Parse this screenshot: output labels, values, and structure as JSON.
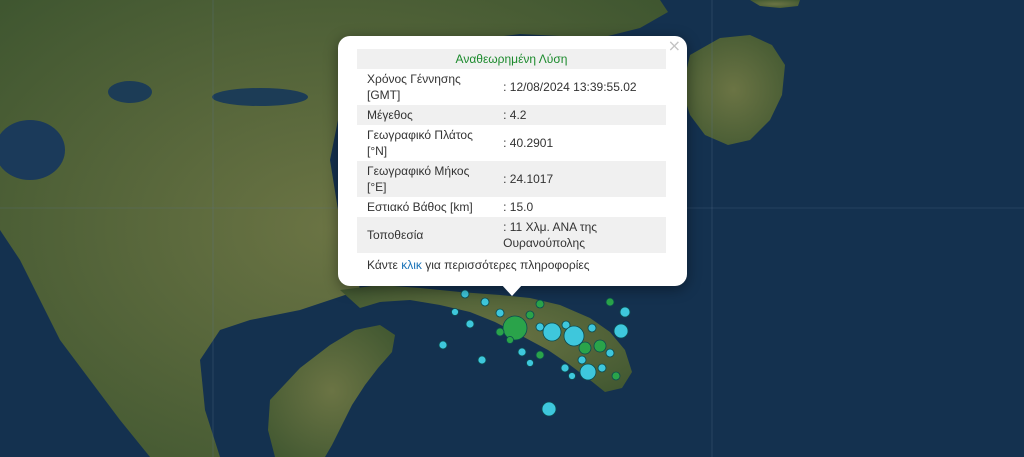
{
  "popup": {
    "header": "Αναθεωρημένη Λύση",
    "rows": [
      {
        "label_line1": "Χρόνος Γέννησης",
        "label_line2": "[GMT]",
        "value": ": 12/08/2024 13:39:55.02"
      },
      {
        "label_line1": "Μέγεθος",
        "label_line2": "",
        "value": ": 4.2"
      },
      {
        "label_line1": "Γεωγραφικό Πλάτος",
        "label_line2": "[°N]",
        "value": ": 40.2901"
      },
      {
        "label_line1": "Γεωγραφικό Μήκος",
        "label_line2": "[°E]",
        "value": ": 24.1017"
      },
      {
        "label_line1": "Εστιακό Βάθος [km]",
        "label_line2": "",
        "value": ": 15.0"
      },
      {
        "label_line1": "Τοποθεσία",
        "label_line2": "",
        "value_line1": ": 11 Χλμ. ΑΝΑ της",
        "value_line2": "Ουρανούπολης"
      }
    ],
    "more_prefix": "Κάντε ",
    "more_link": "κλικ",
    "more_suffix": " για περισσότερες πληροφορίες",
    "close_symbol": "×"
  },
  "colors": {
    "sea": "#14314f",
    "land": "#5a6a3c",
    "marker_recent": "#3ec7dc",
    "marker_older": "#2aa34a",
    "header_text": "#1b8a2c",
    "link": "#1a73b8"
  },
  "markers": [
    {
      "lat": 40.2901,
      "lon": 24.1017,
      "magnitude": 4.2,
      "type": "recent"
    }
  ]
}
